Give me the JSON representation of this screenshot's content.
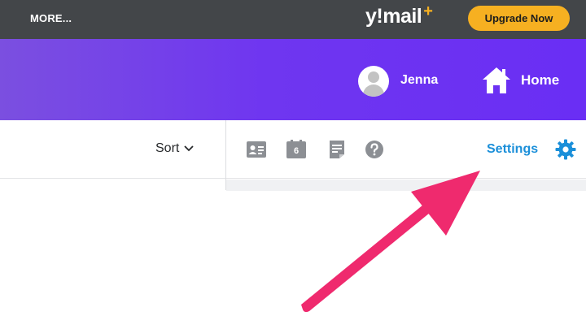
{
  "topbar": {
    "more_label": "MORE...",
    "logo_text": "y!mail",
    "logo_plus": "+",
    "upgrade_label": "Upgrade Now"
  },
  "banner": {
    "user_name": "Jenna",
    "home_label": "Home"
  },
  "toolbar": {
    "sort_label": "Sort",
    "calendar_day": "6",
    "settings_label": "Settings",
    "icons": [
      "contacts-icon",
      "calendar-icon",
      "notepad-icon",
      "help-icon",
      "gear-icon"
    ]
  },
  "colors": {
    "topbar_bg": "#434649",
    "banner_purple": "#6f36f0",
    "upgrade_yellow": "#f6b021",
    "settings_blue": "#1b8fd9",
    "arrow_pink": "#ef2a6e"
  }
}
